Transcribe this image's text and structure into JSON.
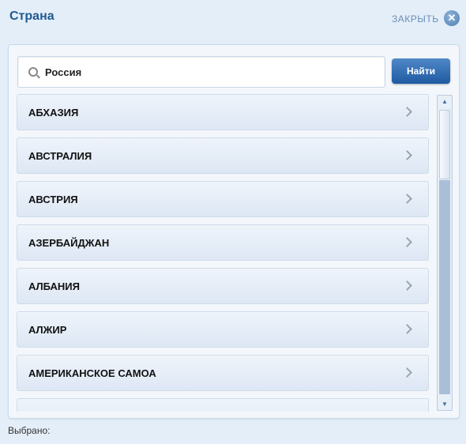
{
  "header": {
    "title": "Страна",
    "close_label": "ЗАКРЫТЬ",
    "close_icon": "close-icon"
  },
  "search": {
    "value": "Россия",
    "icon": "search-icon",
    "button_label": "Найти"
  },
  "countries": [
    {
      "label": "АБХАЗИЯ"
    },
    {
      "label": "АВСТРАЛИЯ"
    },
    {
      "label": "АВСТРИЯ"
    },
    {
      "label": "АЗЕРБАЙДЖАН"
    },
    {
      "label": "АЛБАНИЯ"
    },
    {
      "label": "АЛЖИР"
    },
    {
      "label": "АМЕРИКАНСКОЕ САМОА"
    },
    {
      "label": ""
    }
  ],
  "footer": {
    "selected_label": "Выбрано:"
  },
  "colors": {
    "title": "#1f5a92",
    "button": "#2e6db5",
    "background": "#e4eef8"
  }
}
